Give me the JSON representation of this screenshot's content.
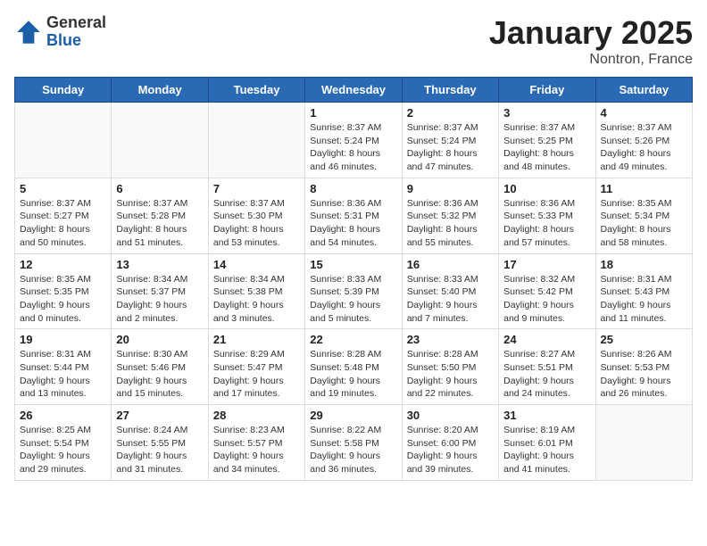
{
  "logo": {
    "general": "General",
    "blue": "Blue"
  },
  "header": {
    "month": "January 2025",
    "location": "Nontron, France"
  },
  "weekdays": [
    "Sunday",
    "Monday",
    "Tuesday",
    "Wednesday",
    "Thursday",
    "Friday",
    "Saturday"
  ],
  "weeks": [
    [
      {
        "day": "",
        "info": ""
      },
      {
        "day": "",
        "info": ""
      },
      {
        "day": "",
        "info": ""
      },
      {
        "day": "1",
        "info": "Sunrise: 8:37 AM\nSunset: 5:24 PM\nDaylight: 8 hours and 46 minutes."
      },
      {
        "day": "2",
        "info": "Sunrise: 8:37 AM\nSunset: 5:24 PM\nDaylight: 8 hours and 47 minutes."
      },
      {
        "day": "3",
        "info": "Sunrise: 8:37 AM\nSunset: 5:25 PM\nDaylight: 8 hours and 48 minutes."
      },
      {
        "day": "4",
        "info": "Sunrise: 8:37 AM\nSunset: 5:26 PM\nDaylight: 8 hours and 49 minutes."
      }
    ],
    [
      {
        "day": "5",
        "info": "Sunrise: 8:37 AM\nSunset: 5:27 PM\nDaylight: 8 hours and 50 minutes."
      },
      {
        "day": "6",
        "info": "Sunrise: 8:37 AM\nSunset: 5:28 PM\nDaylight: 8 hours and 51 minutes."
      },
      {
        "day": "7",
        "info": "Sunrise: 8:37 AM\nSunset: 5:30 PM\nDaylight: 8 hours and 53 minutes."
      },
      {
        "day": "8",
        "info": "Sunrise: 8:36 AM\nSunset: 5:31 PM\nDaylight: 8 hours and 54 minutes."
      },
      {
        "day": "9",
        "info": "Sunrise: 8:36 AM\nSunset: 5:32 PM\nDaylight: 8 hours and 55 minutes."
      },
      {
        "day": "10",
        "info": "Sunrise: 8:36 AM\nSunset: 5:33 PM\nDaylight: 8 hours and 57 minutes."
      },
      {
        "day": "11",
        "info": "Sunrise: 8:35 AM\nSunset: 5:34 PM\nDaylight: 8 hours and 58 minutes."
      }
    ],
    [
      {
        "day": "12",
        "info": "Sunrise: 8:35 AM\nSunset: 5:35 PM\nDaylight: 9 hours and 0 minutes."
      },
      {
        "day": "13",
        "info": "Sunrise: 8:34 AM\nSunset: 5:37 PM\nDaylight: 9 hours and 2 minutes."
      },
      {
        "day": "14",
        "info": "Sunrise: 8:34 AM\nSunset: 5:38 PM\nDaylight: 9 hours and 3 minutes."
      },
      {
        "day": "15",
        "info": "Sunrise: 8:33 AM\nSunset: 5:39 PM\nDaylight: 9 hours and 5 minutes."
      },
      {
        "day": "16",
        "info": "Sunrise: 8:33 AM\nSunset: 5:40 PM\nDaylight: 9 hours and 7 minutes."
      },
      {
        "day": "17",
        "info": "Sunrise: 8:32 AM\nSunset: 5:42 PM\nDaylight: 9 hours and 9 minutes."
      },
      {
        "day": "18",
        "info": "Sunrise: 8:31 AM\nSunset: 5:43 PM\nDaylight: 9 hours and 11 minutes."
      }
    ],
    [
      {
        "day": "19",
        "info": "Sunrise: 8:31 AM\nSunset: 5:44 PM\nDaylight: 9 hours and 13 minutes."
      },
      {
        "day": "20",
        "info": "Sunrise: 8:30 AM\nSunset: 5:46 PM\nDaylight: 9 hours and 15 minutes."
      },
      {
        "day": "21",
        "info": "Sunrise: 8:29 AM\nSunset: 5:47 PM\nDaylight: 9 hours and 17 minutes."
      },
      {
        "day": "22",
        "info": "Sunrise: 8:28 AM\nSunset: 5:48 PM\nDaylight: 9 hours and 19 minutes."
      },
      {
        "day": "23",
        "info": "Sunrise: 8:28 AM\nSunset: 5:50 PM\nDaylight: 9 hours and 22 minutes."
      },
      {
        "day": "24",
        "info": "Sunrise: 8:27 AM\nSunset: 5:51 PM\nDaylight: 9 hours and 24 minutes."
      },
      {
        "day": "25",
        "info": "Sunrise: 8:26 AM\nSunset: 5:53 PM\nDaylight: 9 hours and 26 minutes."
      }
    ],
    [
      {
        "day": "26",
        "info": "Sunrise: 8:25 AM\nSunset: 5:54 PM\nDaylight: 9 hours and 29 minutes."
      },
      {
        "day": "27",
        "info": "Sunrise: 8:24 AM\nSunset: 5:55 PM\nDaylight: 9 hours and 31 minutes."
      },
      {
        "day": "28",
        "info": "Sunrise: 8:23 AM\nSunset: 5:57 PM\nDaylight: 9 hours and 34 minutes."
      },
      {
        "day": "29",
        "info": "Sunrise: 8:22 AM\nSunset: 5:58 PM\nDaylight: 9 hours and 36 minutes."
      },
      {
        "day": "30",
        "info": "Sunrise: 8:20 AM\nSunset: 6:00 PM\nDaylight: 9 hours and 39 minutes."
      },
      {
        "day": "31",
        "info": "Sunrise: 8:19 AM\nSunset: 6:01 PM\nDaylight: 9 hours and 41 minutes."
      },
      {
        "day": "",
        "info": ""
      }
    ]
  ]
}
